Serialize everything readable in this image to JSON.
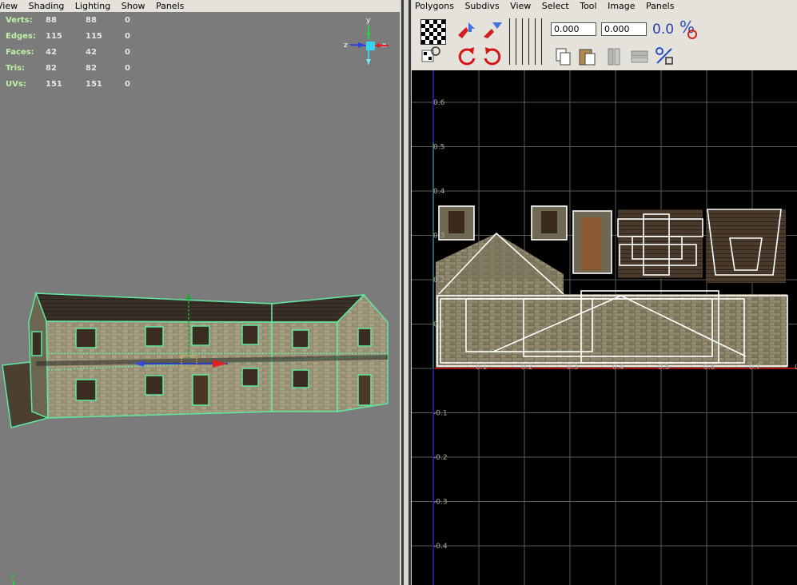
{
  "left_menu": {
    "items": [
      "View",
      "Shading",
      "Lighting",
      "Show",
      "Panels"
    ]
  },
  "right_menu": {
    "items": [
      "Polygons",
      "Subdivs",
      "View",
      "Select",
      "Tool",
      "Image",
      "Panels"
    ]
  },
  "hud": {
    "rows": [
      {
        "label": "Verts:",
        "a": "88",
        "b": "88",
        "c": "0"
      },
      {
        "label": "Edges:",
        "a": "115",
        "b": "115",
        "c": "0"
      },
      {
        "label": "Faces:",
        "a": "42",
        "b": "42",
        "c": "0"
      },
      {
        "label": "Tris:",
        "a": "82",
        "b": "82",
        "c": "0"
      },
      {
        "label": "UVs:",
        "a": "151",
        "b": "151",
        "c": "0"
      }
    ]
  },
  "gizmo": {
    "y": "y",
    "z": "z",
    "x": "x"
  },
  "bottom_axis": {
    "y": "y"
  },
  "toolbar": {
    "u_value": "0.000",
    "v_value": "0.000",
    "zero_label": "0.0"
  },
  "uv_axes": {
    "y_ticks": [
      "0.6",
      "0.5",
      "0.4",
      "0.3",
      "0.2",
      "0.1",
      "-0.1",
      "-0.2",
      "-0.3",
      "-0.4"
    ],
    "x_ticks": [
      "0.1",
      "0.2",
      "0.3",
      "0.4",
      "0.5",
      "0.6",
      "0.7",
      "0.8"
    ]
  },
  "colors": {
    "selection": "#5fe8a2",
    "grid": "#5a5a5a",
    "u_axis": "#a01010",
    "v_axis": "#1a1a9a",
    "hud_label": "#bff2a8"
  }
}
